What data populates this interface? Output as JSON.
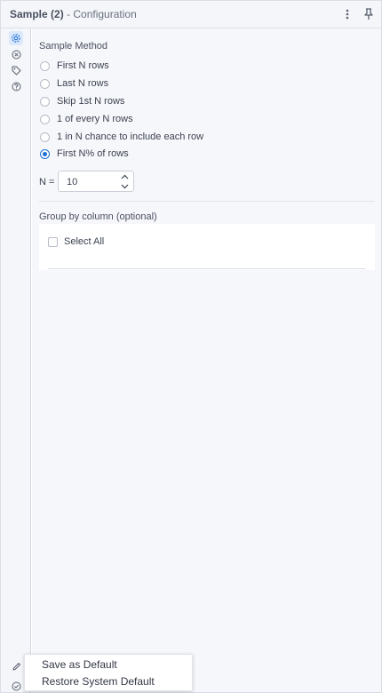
{
  "header": {
    "tool_title": "Sample (2)",
    "separator": " - ",
    "section": "Configuration",
    "icons": [
      "more-vertical-icon",
      "pin-icon"
    ]
  },
  "sidebar": {
    "items": [
      {
        "name": "configuration-icon",
        "active": true
      },
      {
        "name": "annotation-icon",
        "active": false
      },
      {
        "name": "tag-icon",
        "active": false
      },
      {
        "name": "help-icon",
        "active": false
      }
    ],
    "footer_icons": [
      "edit-icon",
      "check-circle-icon"
    ]
  },
  "sample_method": {
    "label": "Sample Method",
    "options": [
      {
        "label": "First N rows",
        "selected": false
      },
      {
        "label": "Last N rows",
        "selected": false
      },
      {
        "label": "Skip 1st N rows",
        "selected": false
      },
      {
        "label": "1 of every N rows",
        "selected": false
      },
      {
        "label": "1 in N chance to include each row",
        "selected": false
      },
      {
        "label": "First N% of rows",
        "selected": true
      }
    ]
  },
  "n_field": {
    "label": "N =",
    "value": "10"
  },
  "group_by": {
    "label": "Group by column (optional)",
    "select_all_label": "Select All",
    "select_all_checked": false
  },
  "context_menu": {
    "items": [
      "Save as Default",
      "Restore System Default"
    ]
  },
  "colors": {
    "accent": "#1c6fd6",
    "header_bg": "#f4f6f9",
    "content_bg": "#f6f7fa"
  }
}
